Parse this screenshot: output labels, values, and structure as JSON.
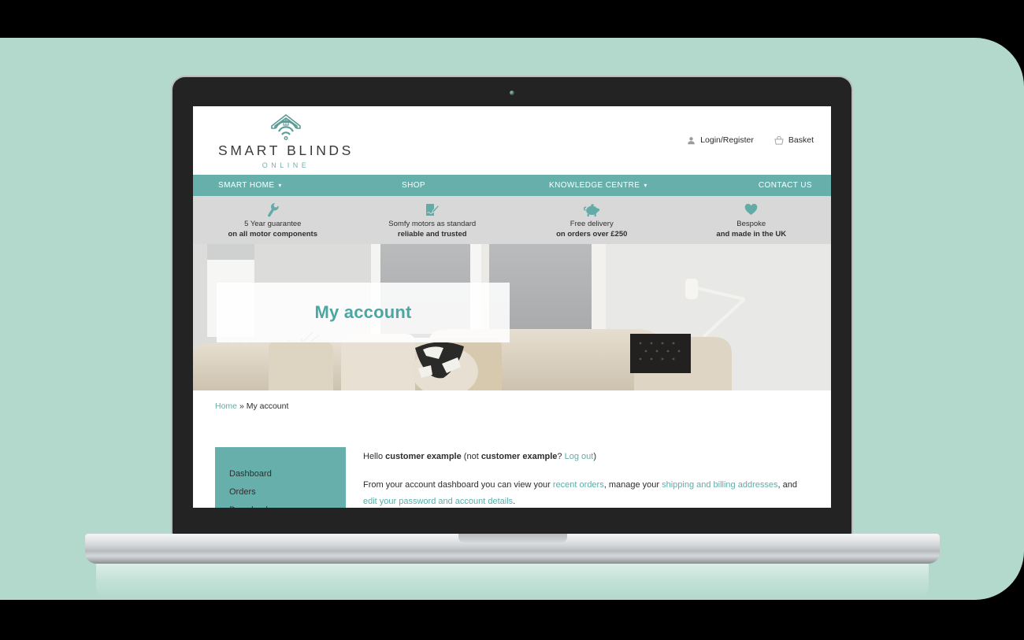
{
  "background": {
    "color": "#b2d9cc",
    "frame_color": "#000000"
  },
  "device": {
    "type": "laptop",
    "bezel_color": "#232323",
    "base_color": "#cfd2d4"
  },
  "site": {
    "logo": {
      "name": "SMART BLINDS",
      "subtitle": "ONLINE",
      "icon": "house-wifi-icon"
    },
    "header_links": [
      {
        "label": "Login/Register",
        "icon": "user-icon"
      },
      {
        "label": "Basket",
        "icon": "basket-icon"
      }
    ],
    "nav": [
      {
        "label": "SMART HOME",
        "has_dropdown": true
      },
      {
        "label": "SHOP",
        "has_dropdown": false
      },
      {
        "label": "KNOWLEDGE CENTRE",
        "has_dropdown": true
      },
      {
        "label": "CONTACT US",
        "has_dropdown": false
      }
    ],
    "usps": [
      {
        "icon": "wrench-icon",
        "line1": "5 Year guarantee",
        "line2": "on all motor components"
      },
      {
        "icon": "signed-document-icon",
        "line1": "Somfy motors as standard",
        "line2": "reliable and trusted"
      },
      {
        "icon": "piggy-bank-icon",
        "line1": "Free delivery",
        "line2": "on orders over £250"
      },
      {
        "icon": "heart-icon",
        "line1": "Bespoke",
        "line2": "and made in the UK"
      }
    ],
    "hero": {
      "title": "My account"
    },
    "breadcrumb": {
      "home": "Home",
      "separator": "»",
      "current": "My account"
    },
    "account": {
      "menu": [
        {
          "label": "Dashboard"
        },
        {
          "label": "Orders"
        },
        {
          "label": "Downloads"
        }
      ],
      "greeting": {
        "prefix": "Hello ",
        "name": "customer example",
        "mid": " (not ",
        "name2": "customer example",
        "q": "? ",
        "logout": "Log out",
        "suffix": ")"
      },
      "dashboard_text": {
        "p1": "From your account dashboard you can view your ",
        "link1": "recent orders",
        "p2": ", manage your ",
        "link2": "shipping and billing addresses",
        "p3": ", and ",
        "link3": "edit your password and account details",
        "p4": "."
      }
    },
    "colors": {
      "accent": "#66afaa",
      "link": "#5eada8",
      "usp_bar": "#d8d8d8"
    }
  }
}
